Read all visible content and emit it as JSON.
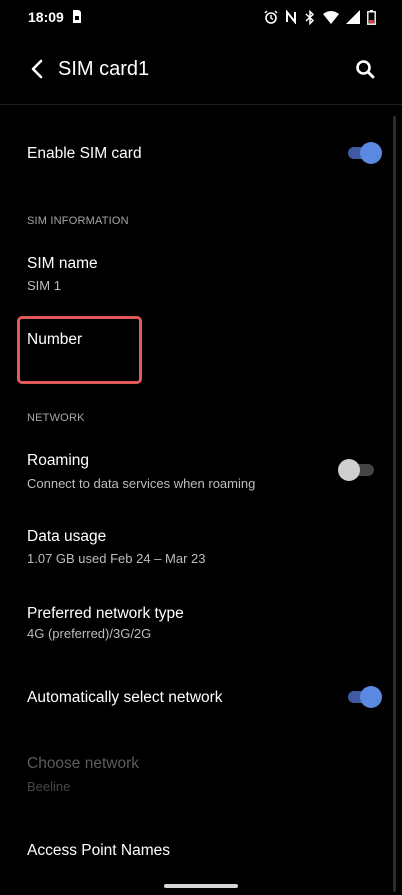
{
  "status_bar": {
    "time": "18:09",
    "left_icon": "sim-card-icon",
    "icons": [
      "alarm-icon",
      "nfc-icon",
      "bluetooth-icon",
      "wifi-icon",
      "signal-icon",
      "battery-low-icon"
    ],
    "battery_color": "#e53935"
  },
  "app_bar": {
    "title": "SIM card1",
    "back_icon": "back-arrow-icon",
    "search_icon": "search-icon"
  },
  "settings": {
    "enable_sim": {
      "label": "Enable SIM card",
      "enabled": true
    },
    "sim_info_header": "SIM INFORMATION",
    "sim_name": {
      "label": "SIM name",
      "value": "SIM 1"
    },
    "number": {
      "label": "Number"
    },
    "network_header": "NETWORK",
    "roaming": {
      "label": "Roaming",
      "summary": "Connect to data services when roaming",
      "enabled": false
    },
    "data_usage": {
      "label": "Data usage",
      "summary": "1.07 GB used Feb 24 – Mar 23"
    },
    "preferred_network": {
      "label": "Preferred network type",
      "summary": "4G (preferred)/3G/2G"
    },
    "auto_select": {
      "label": "Automatically select network",
      "enabled": true
    },
    "choose_network": {
      "label": "Choose network",
      "summary": "Beeline",
      "disabled": true
    },
    "apn": {
      "label": "Access Point Names"
    }
  },
  "colors": {
    "background": "#000000",
    "switch_on": "#5b88e0",
    "highlight": "#e05a5a"
  }
}
